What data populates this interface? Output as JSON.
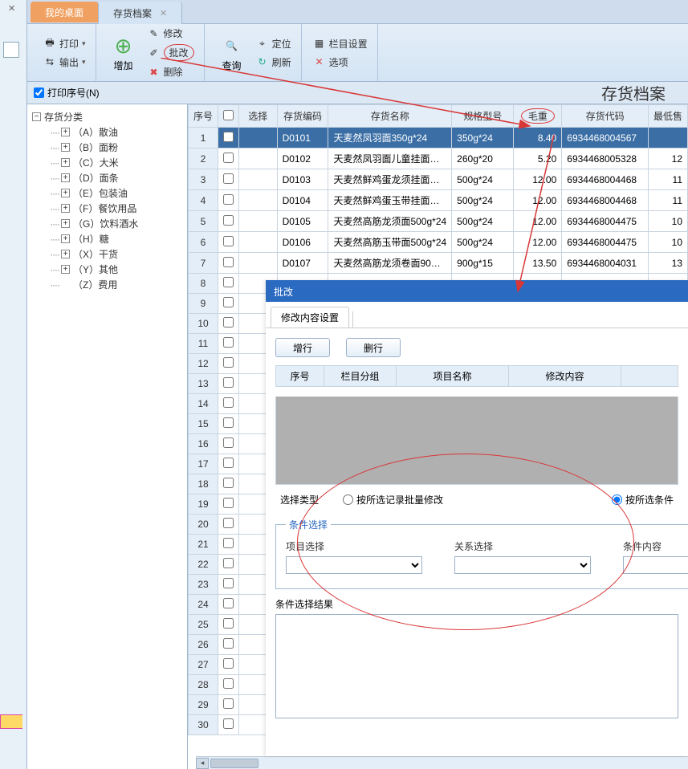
{
  "tabs": {
    "desktop": "我的桌面",
    "inventory": "存货档案"
  },
  "ribbon": {
    "print": "打印",
    "export": "输出",
    "add": "增加",
    "modify": "修改",
    "batch": "批改",
    "delete": "删除",
    "query": "查询",
    "locate": "定位",
    "refresh": "刷新",
    "columns": "栏目设置",
    "options": "选项"
  },
  "subbar": {
    "printSeq": "打印序号(N)"
  },
  "pageTitle": "存货档案",
  "tree": {
    "root": "存货分类",
    "items": [
      "（A）散油",
      "（B）面粉",
      "（C）大米",
      "（D）面条",
      "（E）包装油",
      "（F）餐饮用品",
      "（G）饮料酒水",
      "（H）糖",
      "（X）干货",
      "（Y）其他",
      "（Z）费用"
    ]
  },
  "columns": {
    "seq": "序号",
    "select": "选择",
    "code": "存货编码",
    "name": "存货名称",
    "spec": "规格型号",
    "gross": "毛重",
    "barcode": "存货代码",
    "min": "最低售"
  },
  "rows": [
    {
      "seq": 1,
      "code": "D0101",
      "name": "天麦然凤羽面350g*24",
      "spec": "350g*24",
      "gross": "8.40",
      "barcode": "6934468004567",
      "selected": true
    },
    {
      "seq": 2,
      "code": "D0102",
      "name": "天麦然凤羽面儿童挂面…",
      "spec": "260g*20",
      "gross": "5.20",
      "barcode": "6934468005328",
      "min": "12"
    },
    {
      "seq": 3,
      "code": "D0103",
      "name": "天麦然鲜鸡蛋龙须挂面…",
      "spec": "500g*24",
      "gross": "12.00",
      "barcode": "6934468004468",
      "min": "11"
    },
    {
      "seq": 4,
      "code": "D0104",
      "name": "天麦然鲜鸡蛋玉带挂面…",
      "spec": "500g*24",
      "gross": "12.00",
      "barcode": "6934468004468",
      "min": "11"
    },
    {
      "seq": 5,
      "code": "D0105",
      "name": "天麦然高筋龙须面500g*24",
      "spec": "500g*24",
      "gross": "12.00",
      "barcode": "6934468004475",
      "min": "10"
    },
    {
      "seq": 6,
      "code": "D0106",
      "name": "天麦然高筋玉带面500g*24",
      "spec": "500g*24",
      "gross": "12.00",
      "barcode": "6934468004475",
      "min": "10"
    },
    {
      "seq": 7,
      "code": "D0107",
      "name": "天麦然高筋龙须卷面90…",
      "spec": "900g*15",
      "gross": "13.50",
      "barcode": "6934468004031",
      "min": "13"
    }
  ],
  "emptySeqStart": 8,
  "emptySeqEnd": 30,
  "dialog": {
    "title": "批改",
    "tab": "修改内容设置",
    "addRow": "增行",
    "delRow": "删行",
    "cols": {
      "seq": "序号",
      "group": "栏目分组",
      "item": "项目名称",
      "content": "修改内容"
    },
    "typeLabel": "选择类型",
    "radioByRecord": "按所选记录批量修改",
    "radioByCond": "按所选条件",
    "condGroup": "条件选择",
    "projSelect": "项目选择",
    "relSelect": "关系选择",
    "condContent": "条件内容",
    "resultLabel": "条件选择结果"
  }
}
